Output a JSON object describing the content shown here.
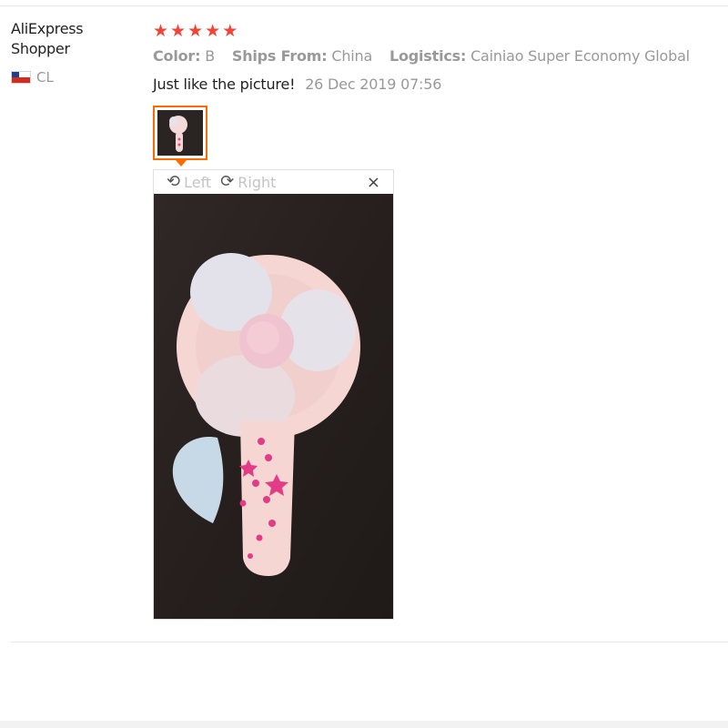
{
  "review": {
    "user": {
      "name": "AliExpress Shopper",
      "country_code": "CL"
    },
    "rating": 5,
    "attributes": [
      {
        "label": "Color:",
        "value": "B"
      },
      {
        "label": "Ships From:",
        "value": "China"
      },
      {
        "label": "Logistics:",
        "value": "Cainiao Super Economy Global"
      }
    ],
    "feedback_text": "Just like the picture!",
    "date": "26 Dec 2019 07:56",
    "photo_viewer": {
      "rotate_left_label": "Left",
      "rotate_right_label": "Right",
      "close_symbol": "×"
    }
  },
  "colors": {
    "star": "#f44336",
    "thumb_border": "#ff6a00",
    "muted_text": "#999999"
  },
  "icons": [
    "flag-cl-icon",
    "star-icon",
    "rotate-left-icon",
    "rotate-right-icon",
    "close-icon"
  ]
}
